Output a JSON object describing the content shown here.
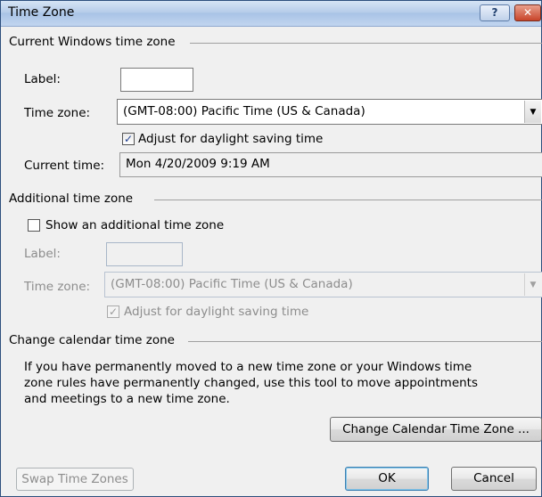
{
  "window": {
    "title": "Time Zone",
    "help_label": "?",
    "close_label": "✕"
  },
  "current": {
    "section_label": "Current Windows time zone",
    "label_label": "Label:",
    "label_value": "",
    "timezone_label": "Time zone:",
    "timezone_value": "(GMT-08:00) Pacific Time (US & Canada)",
    "dst_checked": true,
    "dst_label": "Adjust for daylight saving time",
    "current_time_label": "Current time:",
    "current_time_value": "Mon 4/20/2009 9:19 AM"
  },
  "additional": {
    "section_label": "Additional time zone",
    "show_checked": false,
    "show_label": "Show an additional time zone",
    "label_label": "Label:",
    "label_value": "",
    "timezone_label": "Time zone:",
    "timezone_value": "(GMT-08:00) Pacific Time (US & Canada)",
    "dst_checked": true,
    "dst_label": "Adjust for daylight saving time"
  },
  "calendar": {
    "section_label": "Change calendar time zone",
    "description": "If you have permanently moved to a new time zone or your Windows time zone rules have permanently changed, use this tool to move appointments and meetings to a new time zone.",
    "change_button": "Change Calendar Time Zone ..."
  },
  "footer": {
    "swap_button": "Swap Time Zones",
    "ok_button": "OK",
    "cancel_button": "Cancel"
  },
  "icons": {
    "check_glyph": "✓",
    "dropdown_glyph": "▼"
  }
}
